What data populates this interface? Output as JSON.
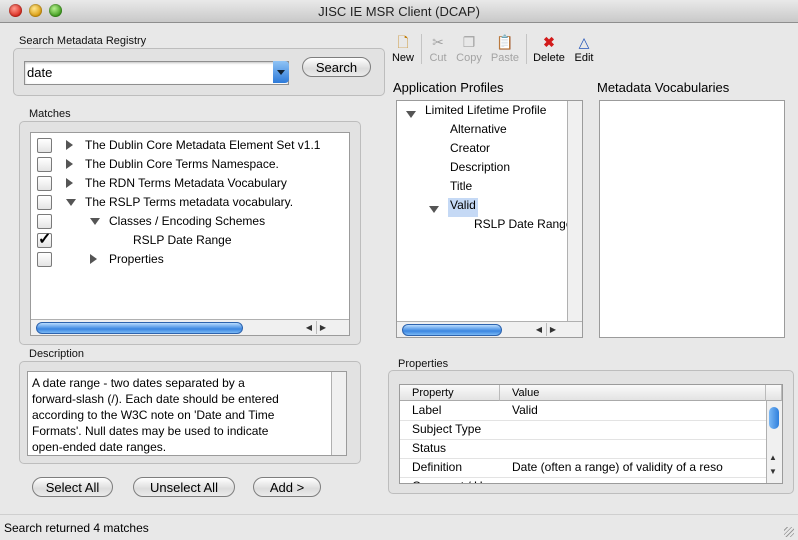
{
  "window": {
    "title": "JISC IE MSR Client (DCAP)"
  },
  "search": {
    "group_label": "Search Metadata Registry",
    "value": "date",
    "button": "Search"
  },
  "matches": {
    "group_label": "Matches",
    "rows": [
      {
        "label": "The Dublin Core Metadata Element Set v1.1",
        "checked": false,
        "expander": "collapsed",
        "level": 0
      },
      {
        "label": "The Dublin Core Terms Namespace.",
        "checked": false,
        "expander": "collapsed",
        "level": 0
      },
      {
        "label": "The RDN Terms Metadata Vocabulary",
        "checked": false,
        "expander": "collapsed",
        "level": 0
      },
      {
        "label": "The RSLP Terms metadata vocabulary.",
        "checked": false,
        "expander": "expanded",
        "level": 0
      },
      {
        "label": "Classes / Encoding Schemes",
        "checked": false,
        "expander": "expanded",
        "level": 1
      },
      {
        "label": "RSLP Date Range",
        "checked": true,
        "expander": "none",
        "level": 2
      },
      {
        "label": "Properties",
        "checked": false,
        "expander": "collapsed",
        "level": 1
      }
    ]
  },
  "description": {
    "group_label": "Description",
    "lines": [
      "A date range - two dates separated by a",
      "forward-slash (/). Each date should be entered",
      "according to the W3C note on 'Date and Time",
      "Formats'. Null dates may be used to indicate",
      "open-ended date ranges."
    ]
  },
  "buttons": {
    "select_all": "Select All",
    "unselect_all": "Unselect All",
    "add": "Add >"
  },
  "toolbar": {
    "new": "New",
    "cut": "Cut",
    "copy": "Copy",
    "paste": "Paste",
    "delete": "Delete",
    "edit": "Edit"
  },
  "application_profiles": {
    "heading": "Application Profiles",
    "root": "Limited Lifetime Profile",
    "items": [
      "Alternative",
      "Creator",
      "Description",
      "Title"
    ],
    "selected": "Valid",
    "child": "RSLP Date Range"
  },
  "metadata_vocabularies": {
    "heading": "Metadata Vocabularies"
  },
  "properties": {
    "group_label": "Properties",
    "columns": [
      "Property",
      "Value"
    ],
    "rows": [
      {
        "property": "Label",
        "value": "Valid"
      },
      {
        "property": "Subject Type",
        "value": ""
      },
      {
        "property": "Status",
        "value": ""
      },
      {
        "property": "Definition",
        "value": "Date (often a range) of validity of a reso"
      },
      {
        "property": "Comment / U",
        "value": ""
      }
    ]
  },
  "status": {
    "text": "Search returned 4 matches"
  }
}
